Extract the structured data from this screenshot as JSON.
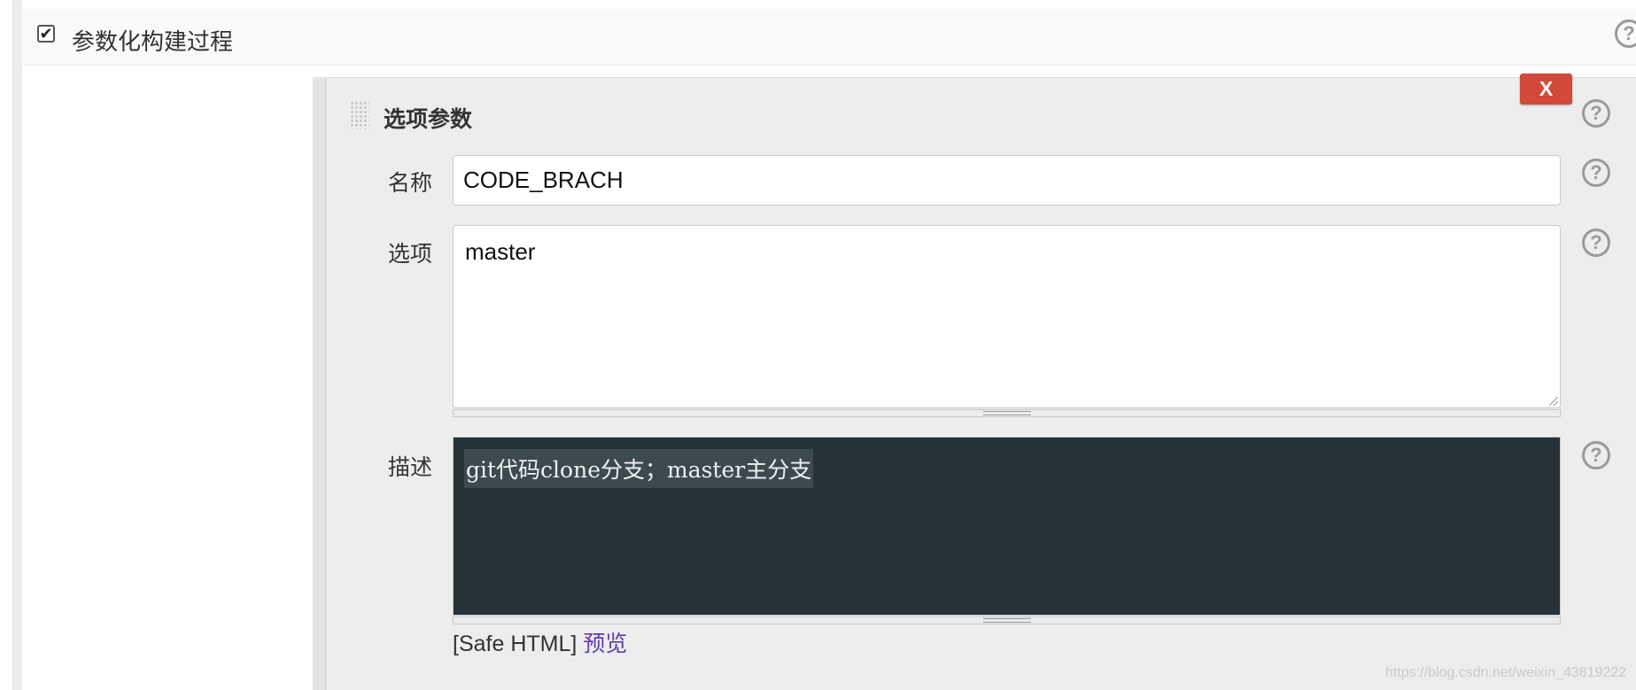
{
  "section": {
    "checkbox_checked": true,
    "checkbox_glyph": "✔",
    "label": "参数化构建过程",
    "help_glyph": "?"
  },
  "parameter": {
    "title": "选项参数",
    "delete_label": "X",
    "help_glyph": "?",
    "fields": {
      "name_label": "名称",
      "name_value": "CODE_BRACH",
      "choices_label": "选项",
      "choices_value": "master",
      "description_label": "描述",
      "description_value": "git代码clone分支；master主分支"
    },
    "safe_html_label": "[Safe HTML]",
    "preview_label": "预览"
  },
  "watermark": "https://blog.csdn.net/weixin_43819222",
  "colors": {
    "delete_button": "#d24939",
    "editor_background": "#263238",
    "link": "#5c3fa8"
  },
  "icons": [
    "checkbox-icon",
    "help-icon",
    "drag-handle-icon",
    "resize-grip-icon"
  ]
}
